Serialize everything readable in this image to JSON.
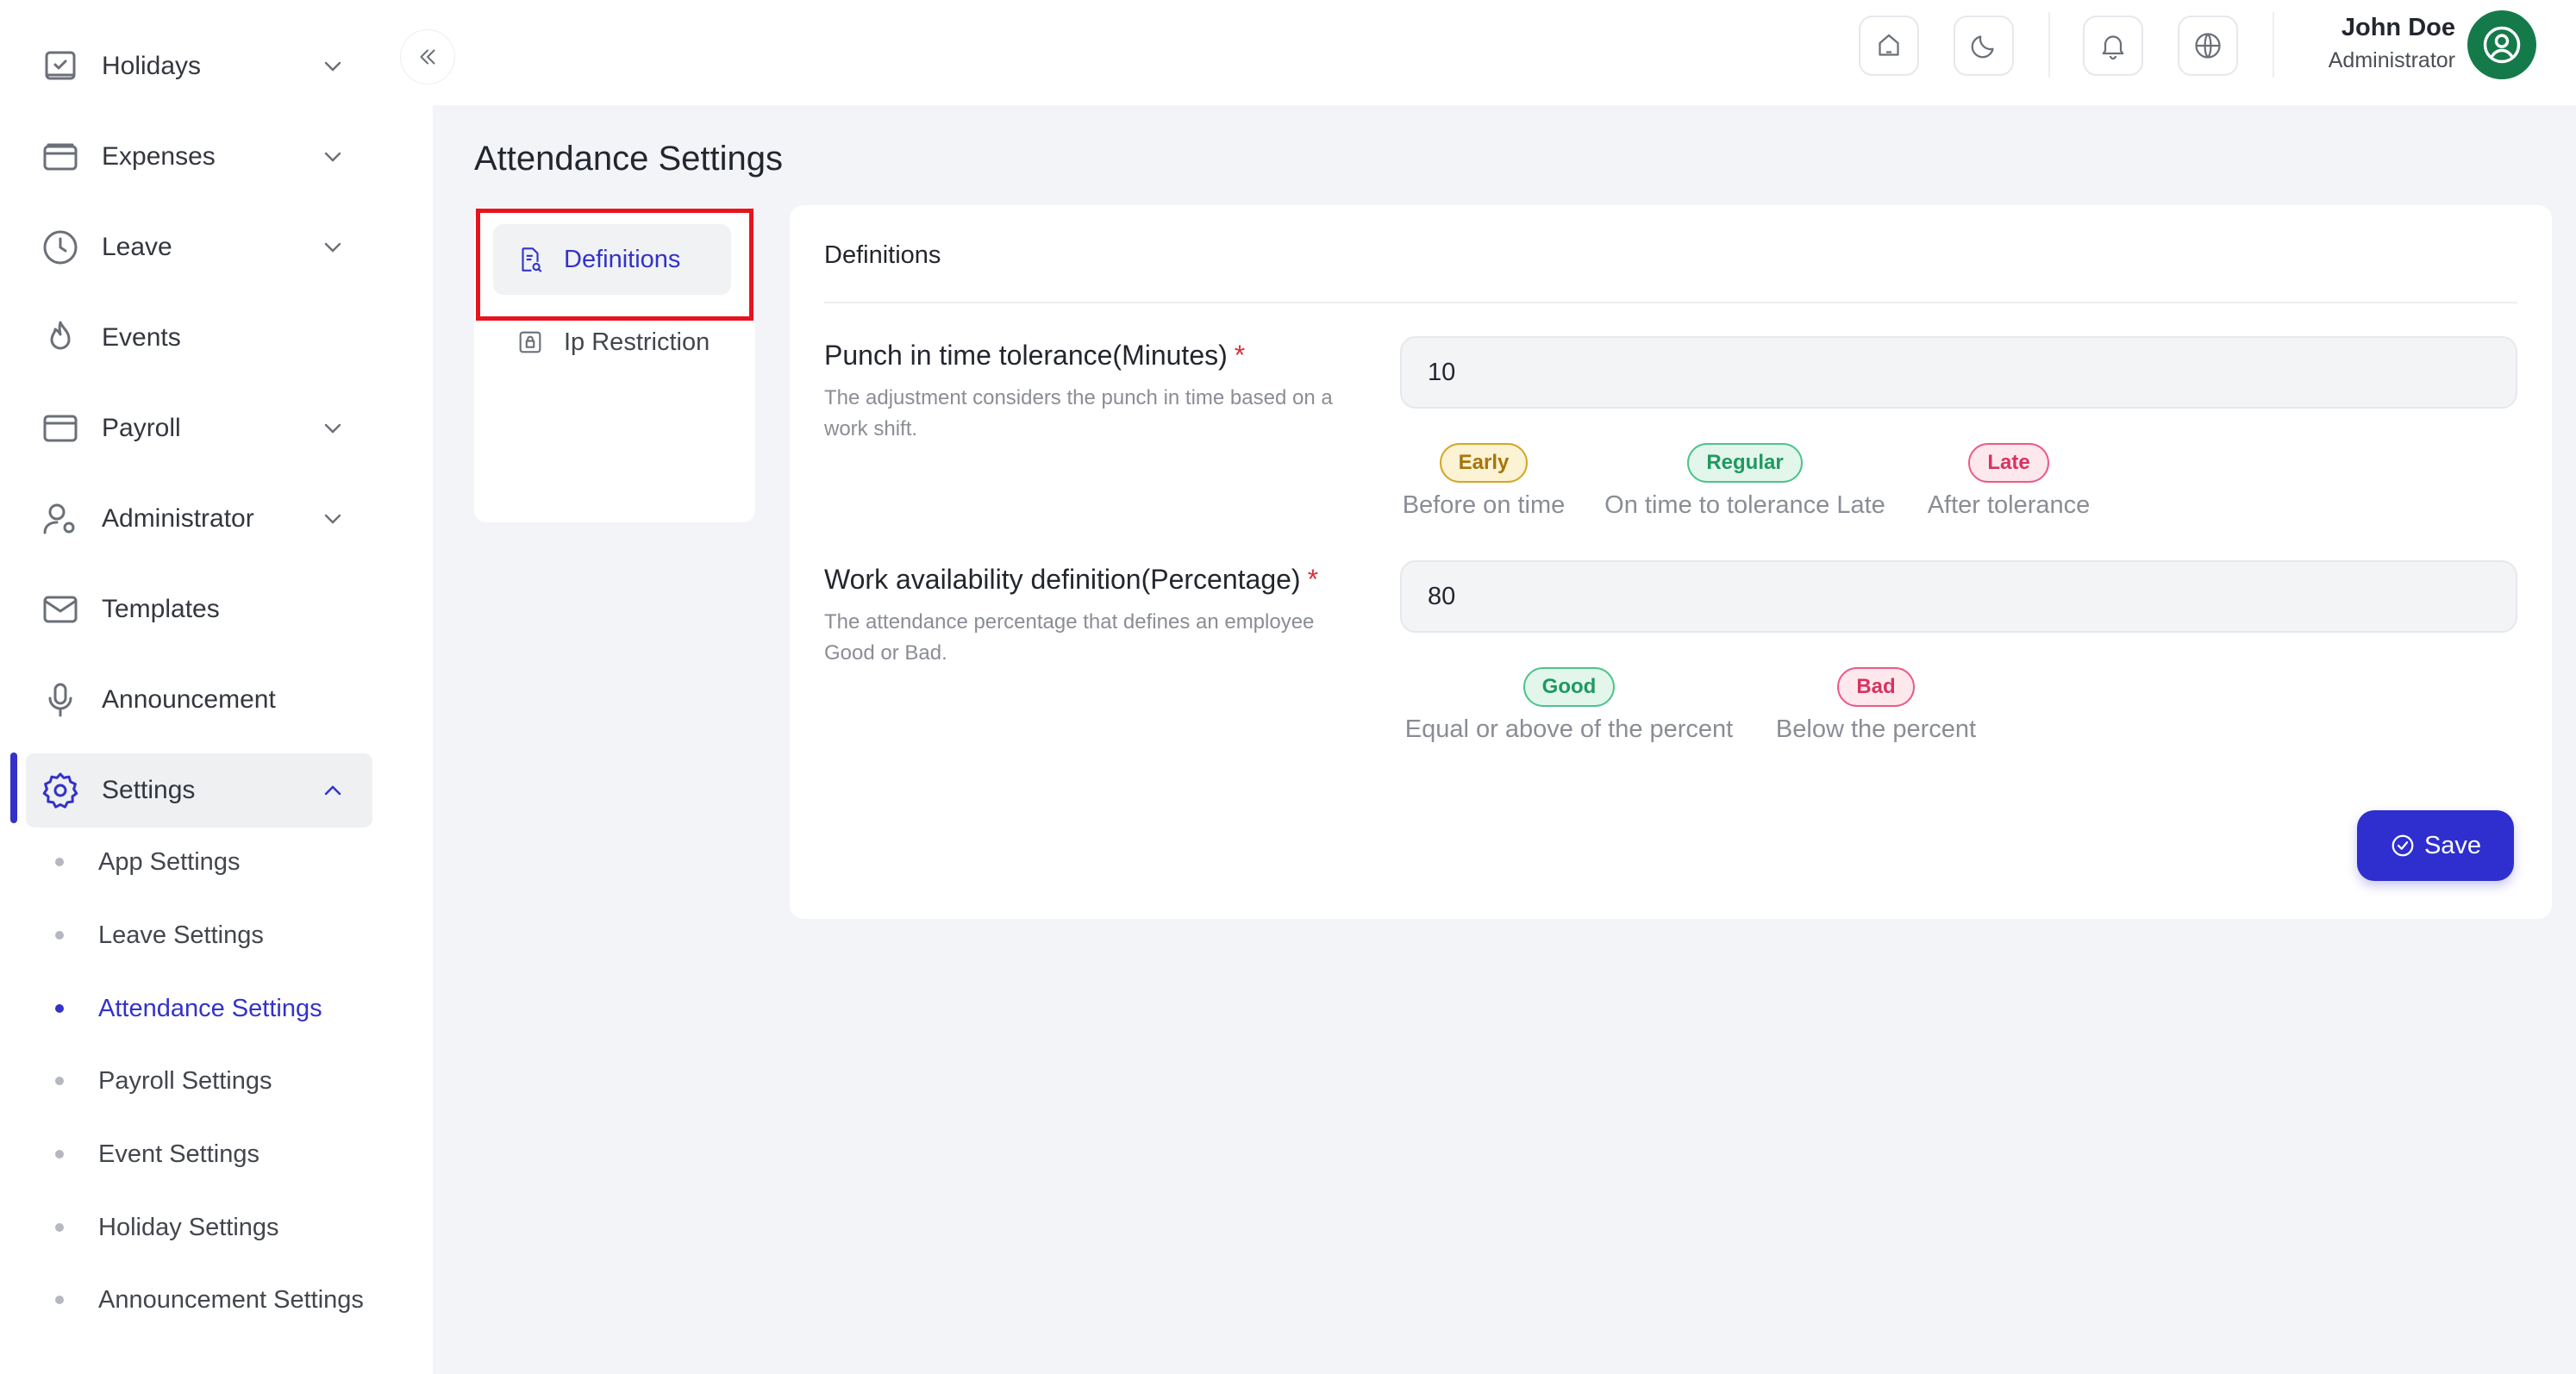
{
  "sidebar": {
    "items": [
      {
        "label": "Holidays",
        "icon": "calendar-check-icon",
        "expandable": true
      },
      {
        "label": "Expenses",
        "icon": "wallet-icon",
        "expandable": true
      },
      {
        "label": "Leave",
        "icon": "clock-icon",
        "expandable": true
      },
      {
        "label": "Events",
        "icon": "flame-icon",
        "expandable": false
      },
      {
        "label": "Payroll",
        "icon": "credit-card-icon",
        "expandable": true
      },
      {
        "label": "Administrator",
        "icon": "user-gear-icon",
        "expandable": true
      },
      {
        "label": "Templates",
        "icon": "envelope-icon",
        "expandable": false
      },
      {
        "label": "Announcement",
        "icon": "microphone-icon",
        "expandable": false
      },
      {
        "label": "Settings",
        "icon": "gear-icon",
        "expandable": true,
        "expanded": true,
        "active": true
      }
    ],
    "settings_sub": [
      {
        "label": "App Settings"
      },
      {
        "label": "Leave Settings"
      },
      {
        "label": "Attendance Settings",
        "current": true
      },
      {
        "label": "Payroll Settings"
      },
      {
        "label": "Event Settings"
      },
      {
        "label": "Holiday Settings"
      },
      {
        "label": "Announcement Settings"
      }
    ]
  },
  "topbar": {
    "icons": [
      "home-icon",
      "moon-icon",
      "bell-icon",
      "globe-icon"
    ],
    "user": {
      "name": "John Doe",
      "role": "Administrator"
    }
  },
  "page": {
    "title": "Attendance Settings",
    "tabs": [
      {
        "label": "Definitions",
        "icon": "document-search-icon",
        "active": true
      },
      {
        "label": "Ip Restriction",
        "icon": "lock-icon",
        "active": false
      }
    ]
  },
  "card": {
    "title": "Definitions",
    "punch": {
      "label": "Punch in time tolerance(Minutes)",
      "required_mark": "*",
      "help": "The adjustment considers the punch in time based on a work shift.",
      "value": "10",
      "legend": [
        {
          "badge": "Early",
          "text": "Before on time"
        },
        {
          "badge": "Regular",
          "text": "On time to tolerance Late"
        },
        {
          "badge": "Late",
          "text": "After tolerance"
        }
      ]
    },
    "availability": {
      "label": "Work availability definition(Percentage)",
      "required_mark": "*",
      "help": "The attendance percentage that defines an employee Good or Bad.",
      "value": "80",
      "legend": [
        {
          "badge": "Good",
          "text": "Equal or above of the percent"
        },
        {
          "badge": "Bad",
          "text": "Below the percent"
        }
      ]
    },
    "save_label": "Save"
  },
  "colors": {
    "accent": "#3432c8",
    "highlight": "#e8141d",
    "avatar": "#157a4a"
  }
}
